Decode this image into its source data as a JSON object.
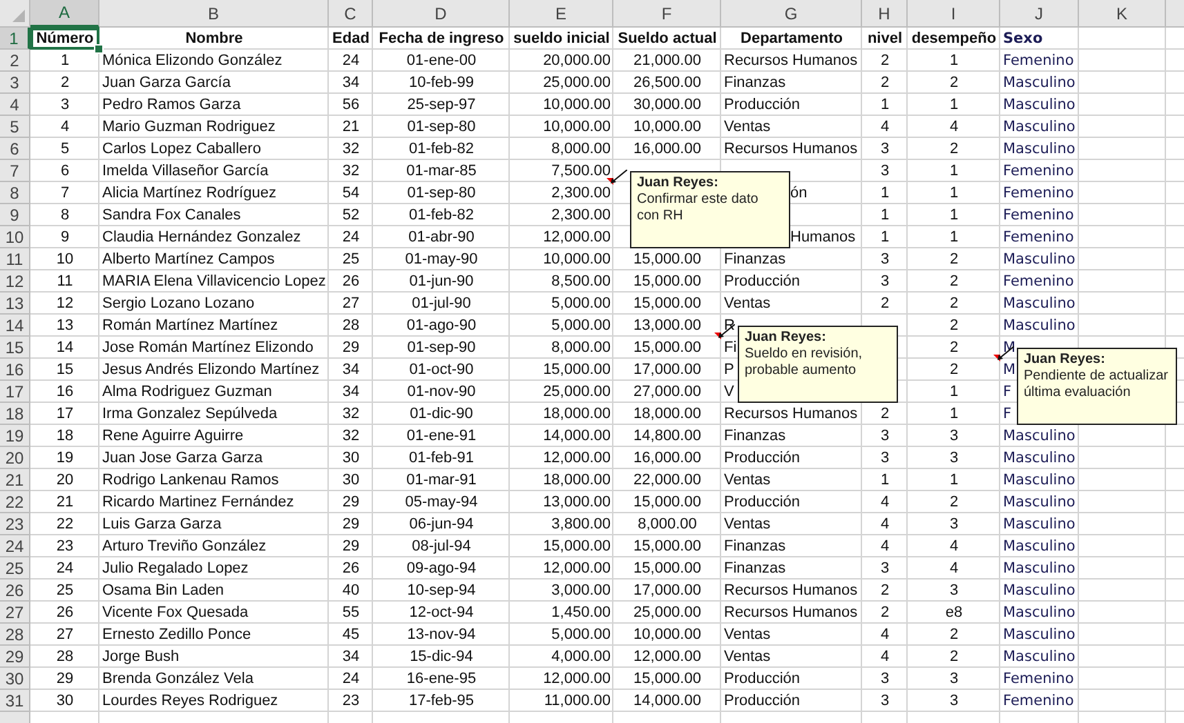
{
  "column_letters": [
    "A",
    "B",
    "C",
    "D",
    "E",
    "F",
    "G",
    "H",
    "I",
    "J",
    "K"
  ],
  "header_row": {
    "number": "1",
    "cells": [
      {
        "text": "Número",
        "selected": true
      },
      "Nombre",
      "Edad",
      "Fecha de ingreso",
      "sueldo inicial",
      "Sueldo actual",
      "Departamento",
      "nivel",
      "desempeño",
      "Sexo"
    ]
  },
  "rows": [
    {
      "number": "2",
      "cells": [
        "1",
        "Mónica Elizondo González",
        "24",
        "01-ene-00",
        "20,000.00",
        "21,000.00",
        "Recursos Humanos",
        "2",
        "1",
        "Femenino"
      ]
    },
    {
      "number": "3",
      "cells": [
        "2",
        "Juan Garza García",
        "34",
        "10-feb-99",
        "25,000.00",
        "26,500.00",
        "Finanzas",
        "2",
        "2",
        "Masculino"
      ]
    },
    {
      "number": "4",
      "cells": [
        "3",
        "Pedro Ramos Garza",
        "56",
        "25-sep-97",
        "10,000.00",
        "30,000.00",
        "Producción",
        "1",
        "1",
        "Masculino"
      ]
    },
    {
      "number": "5",
      "cells": [
        "4",
        "Mario Guzman Rodriguez",
        "21",
        "01-sep-80",
        "10,000.00",
        "10,000.00",
        "Ventas",
        "4",
        "4",
        "Masculino"
      ]
    },
    {
      "number": "6",
      "cells": [
        "5",
        "Carlos Lopez Caballero",
        "32",
        "01-feb-82",
        "8,000.00",
        "16,000.00",
        "Recursos Humanos",
        "3",
        "2",
        "Masculino"
      ]
    },
    {
      "number": "7",
      "cells": [
        "6",
        "Imelda Villaseñor García",
        "32",
        "01-mar-85",
        "7,500.00",
        null,
        null,
        "3",
        "1",
        "Femenino"
      ]
    },
    {
      "number": "8",
      "cells": [
        "7",
        "Alicia Martínez Rodríguez",
        "54",
        "01-sep-80",
        {
          "text": "2,300.00",
          "comment": {
            "author": "Juan Reyes:",
            "text": "Confirmar este dato con RH"
          }
        },
        null,
        {
          "text": "ón",
          "kind": "tail"
        },
        "1",
        "1",
        "Femenino"
      ]
    },
    {
      "number": "9",
      "cells": [
        "8",
        "Sandra Fox Canales",
        "52",
        "01-feb-82",
        "2,300.00",
        null,
        null,
        "1",
        "1",
        "Femenino"
      ]
    },
    {
      "number": "10",
      "cells": [
        "9",
        "Claudia Hernández Gonzalez",
        "24",
        "01-abr-90",
        "12,000.00",
        null,
        {
          "text": "Humanos",
          "kind": "tail"
        },
        "1",
        "1",
        "Femenino"
      ]
    },
    {
      "number": "11",
      "cells": [
        "10",
        "Alberto Martínez Campos",
        "25",
        "01-may-90",
        "10,000.00",
        "15,000.00",
        "Finanzas",
        "3",
        "2",
        "Masculino"
      ]
    },
    {
      "number": "12",
      "cells": [
        "11",
        "MARIA Elena Villavicencio Lopez",
        "26",
        "01-jun-90",
        "8,500.00",
        "15,000.00",
        "Producción",
        "3",
        "2",
        "Femenino"
      ]
    },
    {
      "number": "13",
      "cells": [
        "12",
        "Sergio Lozano Lozano",
        "27",
        "01-jul-90",
        "5,000.00",
        "15,000.00",
        "Ventas",
        "2",
        "2",
        "Masculino"
      ]
    },
    {
      "number": "14",
      "cells": [
        "13",
        "Román Martínez Martínez",
        "28",
        "01-ago-90",
        "5,000.00",
        "13,000.00",
        "R",
        null,
        "2",
        "Masculino"
      ]
    },
    {
      "number": "15",
      "cells": [
        "14",
        "Jose Román Martínez Elizondo",
        "29",
        "01-sep-90",
        "8,000.00",
        {
          "text": "15,000.00",
          "comment": {
            "author": "Juan Reyes:",
            "text": "Sueldo en revisión, probable aumento"
          }
        },
        "Fi",
        null,
        "2",
        "M"
      ]
    },
    {
      "number": "16",
      "cells": [
        "15",
        "Jesus Andrés Elizondo Martínez",
        "34",
        "01-oct-90",
        "15,000.00",
        "17,000.00",
        "P",
        null,
        {
          "text": "2",
          "comment": {
            "author": "Juan Reyes:",
            "text": "Pendiente de actualizar última evaluación"
          }
        },
        "M"
      ]
    },
    {
      "number": "17",
      "cells": [
        "16",
        "Alma Rodriguez Guzman",
        "34",
        "01-nov-90",
        "25,000.00",
        "27,000.00",
        "V",
        null,
        "1",
        "F"
      ]
    },
    {
      "number": "18",
      "cells": [
        "17",
        "Irma Gonzalez Sepúlveda",
        "32",
        "01-dic-90",
        "18,000.00",
        "18,000.00",
        "Recursos Humanos",
        "2",
        "1",
        "F"
      ]
    },
    {
      "number": "19",
      "cells": [
        "18",
        "Rene Aguirre Aguirre",
        "32",
        "01-ene-91",
        "14,000.00",
        "14,800.00",
        "Finanzas",
        "3",
        "3",
        "Masculino"
      ]
    },
    {
      "number": "20",
      "cells": [
        "19",
        "Juan Jose Garza Garza",
        "30",
        "01-feb-91",
        "12,000.00",
        "16,000.00",
        "Producción",
        "3",
        "3",
        "Masculino"
      ]
    },
    {
      "number": "21",
      "cells": [
        "20",
        "Rodrigo Lankenau Ramos",
        "30",
        "01-mar-91",
        "18,000.00",
        "22,000.00",
        "Ventas",
        "1",
        "1",
        "Masculino"
      ]
    },
    {
      "number": "22",
      "cells": [
        "21",
        "Ricardo Martinez Fernández",
        "29",
        "05-may-94",
        "13,000.00",
        "15,000.00",
        "Producción",
        "4",
        "2",
        "Masculino"
      ]
    },
    {
      "number": "23",
      "cells": [
        "22",
        "Luis Garza Garza",
        "29",
        "06-jun-94",
        "3,800.00",
        "8,000.00",
        "Ventas",
        "4",
        "3",
        "Masculino"
      ]
    },
    {
      "number": "24",
      "cells": [
        "23",
        "Arturo Treviño González",
        "29",
        "08-jul-94",
        "15,000.00",
        "15,000.00",
        "Finanzas",
        "4",
        "4",
        "Masculino"
      ]
    },
    {
      "number": "25",
      "cells": [
        "24",
        "Julio Regalado Lopez",
        "26",
        "09-ago-94",
        "12,000.00",
        "15,000.00",
        "Finanzas",
        "3",
        "4",
        "Masculino"
      ]
    },
    {
      "number": "26",
      "cells": [
        "25",
        "Osama Bin Laden",
        "40",
        "10-sep-94",
        "3,000.00",
        "17,000.00",
        "Recursos Humanos",
        "2",
        "3",
        "Masculino"
      ]
    },
    {
      "number": "27",
      "cells": [
        "26",
        "Vicente Fox Quesada",
        "55",
        "12-oct-94",
        "1,450.00",
        "25,000.00",
        "Recursos Humanos",
        "2",
        "e8",
        "Masculino"
      ]
    },
    {
      "number": "28",
      "cells": [
        "27",
        "Ernesto Zedillo Ponce",
        "45",
        "13-nov-94",
        "5,000.00",
        "10,000.00",
        "Ventas",
        "4",
        "2",
        "Masculino"
      ]
    },
    {
      "number": "29",
      "cells": [
        "28",
        "Jorge Bush",
        "34",
        "15-dic-94",
        "4,000.00",
        "12,000.00",
        "Ventas",
        "4",
        "2",
        "Masculino"
      ]
    },
    {
      "number": "30",
      "cells": [
        "29",
        "Brenda González Vela",
        "24",
        "16-ene-95",
        "12,000.00",
        "15,000.00",
        "Producción",
        "3",
        "3",
        "Femenino"
      ]
    },
    {
      "number": "31",
      "cells": [
        "30",
        "Lourdes Reyes Rodriguez",
        "23",
        "17-feb-95",
        "11,000.00",
        "14,000.00",
        "Producción",
        "3",
        "3",
        "Femenino"
      ]
    }
  ]
}
